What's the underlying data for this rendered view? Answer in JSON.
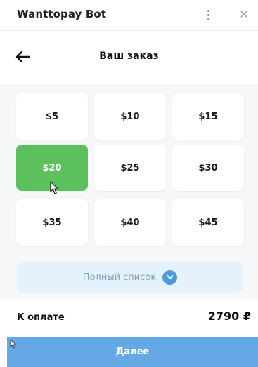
{
  "window": {
    "title": "Wanttopay Bot"
  },
  "header": {
    "title": "Ваш заказ"
  },
  "amounts": [
    {
      "label": "$5",
      "selected": false
    },
    {
      "label": "$10",
      "selected": false
    },
    {
      "label": "$15",
      "selected": false
    },
    {
      "label": "$20",
      "selected": true
    },
    {
      "label": "$25",
      "selected": false
    },
    {
      "label": "$30",
      "selected": false
    },
    {
      "label": "$35",
      "selected": false
    },
    {
      "label": "$40",
      "selected": false
    },
    {
      "label": "$45",
      "selected": false
    }
  ],
  "full_list": {
    "label": "Полный список"
  },
  "total": {
    "label": "К оплате",
    "value": "2790 ₽"
  },
  "continue": {
    "label": "Далее"
  },
  "colors": {
    "selected": "#5cc15c",
    "accent": "#64a9e6",
    "full_list_bg": "#e6f2fb"
  }
}
